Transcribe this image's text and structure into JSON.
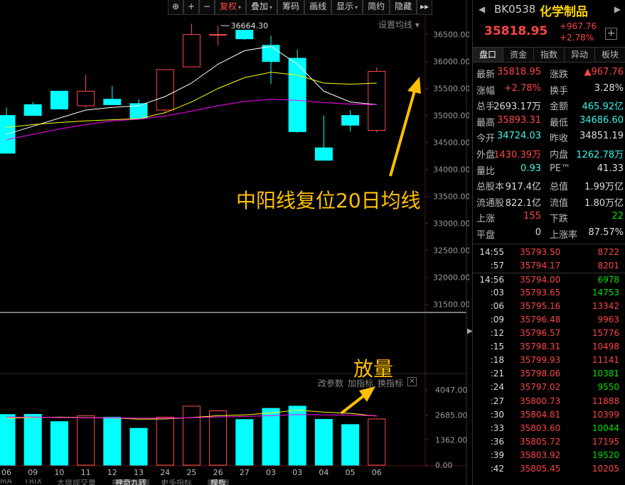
{
  "toolbar": {
    "items": [
      {
        "label": "⊕",
        "icon": "lock-icon"
      },
      {
        "label": "+",
        "icon": "zoom-in-icon"
      },
      {
        "label": "−",
        "icon": "zoom-out-icon"
      },
      {
        "label": "复权",
        "dropdown": true,
        "accent": "#ff4040"
      },
      {
        "label": "叠加",
        "dropdown": true
      },
      {
        "label": "筹码"
      },
      {
        "label": "画线"
      },
      {
        "label": "显示",
        "dropdown": true
      },
      {
        "label": "简约"
      },
      {
        "label": "隐藏"
      }
    ],
    "more": "▸▸",
    "settings_ma": "设置均线 ▾"
  },
  "chart_data": [
    {
      "type": "candlestick",
      "x": [
        "06",
        "09",
        "10",
        "11",
        "12",
        "13",
        "24",
        "25",
        "26",
        "27",
        "03",
        "03",
        "04",
        "05",
        "06"
      ],
      "ohlc": [
        [
          35000,
          35150,
          34650,
          34300
        ],
        [
          35200,
          35250,
          35000,
          35000
        ],
        [
          35450,
          35450,
          35180,
          35120
        ],
        [
          35180,
          35750,
          35150,
          35450
        ],
        [
          35300,
          35550,
          35200,
          35200
        ],
        [
          35220,
          35300,
          34950,
          34950
        ],
        [
          35100,
          35850,
          35050,
          35850
        ],
        [
          35900,
          36700,
          35900,
          36500
        ],
        [
          36500,
          36664,
          36300,
          36500
        ],
        [
          36580,
          36580,
          36400,
          36420
        ],
        [
          36300,
          36480,
          35580,
          36000
        ],
        [
          36060,
          36220,
          34680,
          34700
        ],
        [
          34400,
          35000,
          34400,
          34170
        ],
        [
          35000,
          35100,
          34700,
          34820
        ],
        [
          34724,
          35893,
          34686,
          35818
        ]
      ],
      "ma_lines": [
        {
          "name": "MA5",
          "color": "#ffffff",
          "values": [
            34650,
            34800,
            34950,
            35100,
            35150,
            35180,
            35350,
            35600,
            35950,
            36200,
            36280,
            35950,
            35450,
            35250,
            35200
          ]
        },
        {
          "name": "MA10",
          "color": "#ffff00",
          "values": [
            34780,
            34830,
            34870,
            34900,
            34920,
            34940,
            35050,
            35250,
            35500,
            35700,
            35800,
            35750,
            35600,
            35580,
            35600
          ]
        },
        {
          "name": "MA20",
          "color": "#ff00ff",
          "values": [
            34550,
            34650,
            34750,
            34830,
            34900,
            34930,
            34990,
            35080,
            35180,
            35260,
            35300,
            35280,
            35240,
            35210,
            35200
          ]
        }
      ],
      "peak_label": "36664.30",
      "y_ticks": [
        36500,
        36000,
        35500,
        35000,
        34500,
        34000,
        33500,
        33000,
        32500,
        32000,
        31500
      ],
      "y_tick_labels": [
        "36500.00",
        "36000.00",
        "35500.00",
        "35000.00",
        "34500.00",
        "34000.00",
        "33500.00",
        "33000.00",
        "32500.00",
        "32000.00",
        "31500.00"
      ],
      "ylim": [
        31350,
        36850
      ],
      "colors": {
        "up": "#ff4a4a",
        "down": "#00ffff"
      }
    },
    {
      "type": "bar",
      "title": "",
      "x": [
        "06",
        "09",
        "10",
        "11",
        "12",
        "13",
        "24",
        "25",
        "26",
        "27",
        "03",
        "03",
        "04",
        "05",
        "06"
      ],
      "values": [
        2720,
        2730,
        2340,
        2660,
        2570,
        1980,
        2580,
        3170,
        2920,
        2450,
        3050,
        3170,
        2460,
        2180,
        2480
      ],
      "ma_lines": [
        {
          "name": "MA5",
          "color": "#ffff00",
          "values": [
            2520,
            2560,
            2580,
            2560,
            2540,
            2470,
            2480,
            2560,
            2660,
            2700,
            2800,
            2960,
            2850,
            2780,
            2640
          ]
        },
        {
          "name": "MA10",
          "color": "#ff00ff",
          "values": [
            2580,
            2580,
            2560,
            2550,
            2540,
            2520,
            2520,
            2550,
            2590,
            2620,
            2660,
            2720,
            2700,
            2680,
            2660
          ]
        }
      ],
      "y_ticks": [
        4047,
        2685,
        1362,
        0
      ],
      "y_tick_labels": [
        "4047.00",
        "2685.00",
        "1362.00",
        "0.00"
      ],
      "ylim": [
        0,
        4300
      ],
      "colors": {
        "up": "#ff4a4a",
        "down": "#00ffff"
      }
    }
  ],
  "annotations": {
    "main_text": "中阳线复位20日均线",
    "volume_text": "放量",
    "color": "#ffc000"
  },
  "volume_toolbar": {
    "items": [
      "改参数",
      "加指标",
      "换指标"
    ],
    "close": "✕"
  },
  "bottom_tabs": [
    "MA",
    "TRIX",
    "大盘成交量",
    "神奇九转",
    "更多指标",
    "模板"
  ],
  "panel": {
    "nav_left": "◀",
    "nav_right": "▶",
    "code": "BK0538",
    "name": "化学制品",
    "price": "35818.95",
    "change": "+967.76",
    "change_pct": "+2.78%",
    "add": "+",
    "tabs": [
      "盘口",
      "资金",
      "指数",
      "异动",
      "板块"
    ],
    "stats": [
      {
        "l": "最新",
        "lv": "35818.95",
        "lc": "red",
        "r": "涨跌",
        "rv": "▲967.76",
        "rc": "red"
      },
      {
        "l": "涨幅",
        "lv": "+2.78%",
        "lc": "red",
        "r": "换手",
        "rv": "3.28%",
        "rc": "white"
      },
      {
        "l": "总手",
        "lv": "2693.17万",
        "lc": "white",
        "r": "金额",
        "rv": "465.92亿",
        "rc": "cyan"
      },
      {
        "l": "最高",
        "lv": "35893.31",
        "lc": "red",
        "r": "最低",
        "rv": "34686.60",
        "rc": "cyan"
      },
      {
        "l": "今开",
        "lv": "34724.03",
        "lc": "cyan",
        "r": "昨收",
        "rv": "34851.19",
        "rc": "white"
      },
      {
        "l": "外盘",
        "lv": "1430.39万",
        "lc": "red",
        "r": "内盘",
        "rv": "1262.78万",
        "rc": "cyan"
      },
      {
        "l": "量比",
        "lv": "0.93",
        "lc": "cyan",
        "r": "PE™",
        "rv": "41.33",
        "rc": "white"
      },
      {
        "l": "总股本",
        "lv": "917.4亿",
        "lc": "white",
        "r": "总值",
        "rv": "1.99万亿",
        "rc": "white"
      },
      {
        "l": "流通股",
        "lv": "822.1亿",
        "lc": "white",
        "r": "流值",
        "rv": "1.80万亿",
        "rc": "white"
      },
      {
        "l": "上涨",
        "lv": "155",
        "lc": "red",
        "r": "下跌",
        "rv": "22",
        "rc": "green"
      },
      {
        "l": "平盘",
        "lv": "0",
        "lc": "white",
        "r": "上涨率",
        "rv": "87.57%",
        "rc": "white"
      }
    ],
    "ticks": [
      {
        "t": "14:55",
        "p": "35793.50",
        "v": "8722",
        "vc": "red"
      },
      {
        "t": ":57",
        "p": "35794.17",
        "v": "8201",
        "vc": "red"
      },
      {
        "t": "14:56",
        "p": "35794.00",
        "v": "6978",
        "vc": "green",
        "div": true
      },
      {
        "t": ":03",
        "p": "35793.65",
        "v": "14753",
        "vc": "green"
      },
      {
        "t": ":06",
        "p": "35795.16",
        "v": "13342",
        "vc": "red"
      },
      {
        "t": ":09",
        "p": "35796.48",
        "v": "9963",
        "vc": "red"
      },
      {
        "t": ":12",
        "p": "35796.57",
        "v": "15776",
        "vc": "red"
      },
      {
        "t": ":15",
        "p": "35798.31",
        "v": "10498",
        "vc": "red"
      },
      {
        "t": ":18",
        "p": "35799.93",
        "v": "11141",
        "vc": "red"
      },
      {
        "t": ":21",
        "p": "35798.06",
        "v": "10381",
        "vc": "green"
      },
      {
        "t": ":24",
        "p": "35797.02",
        "v": "9550",
        "vc": "green"
      },
      {
        "t": ":27",
        "p": "35800.73",
        "v": "11888",
        "vc": "red"
      },
      {
        "t": ":30",
        "p": "35804.81",
        "v": "10399",
        "vc": "red"
      },
      {
        "t": ":33",
        "p": "35803.60",
        "v": "10044",
        "vc": "green"
      },
      {
        "t": ":36",
        "p": "35805.72",
        "v": "17195",
        "vc": "red"
      },
      {
        "t": ":39",
        "p": "35803.92",
        "v": "19520",
        "vc": "green"
      },
      {
        "t": ":42",
        "p": "35805.45",
        "v": "10205",
        "vc": "red"
      }
    ]
  }
}
